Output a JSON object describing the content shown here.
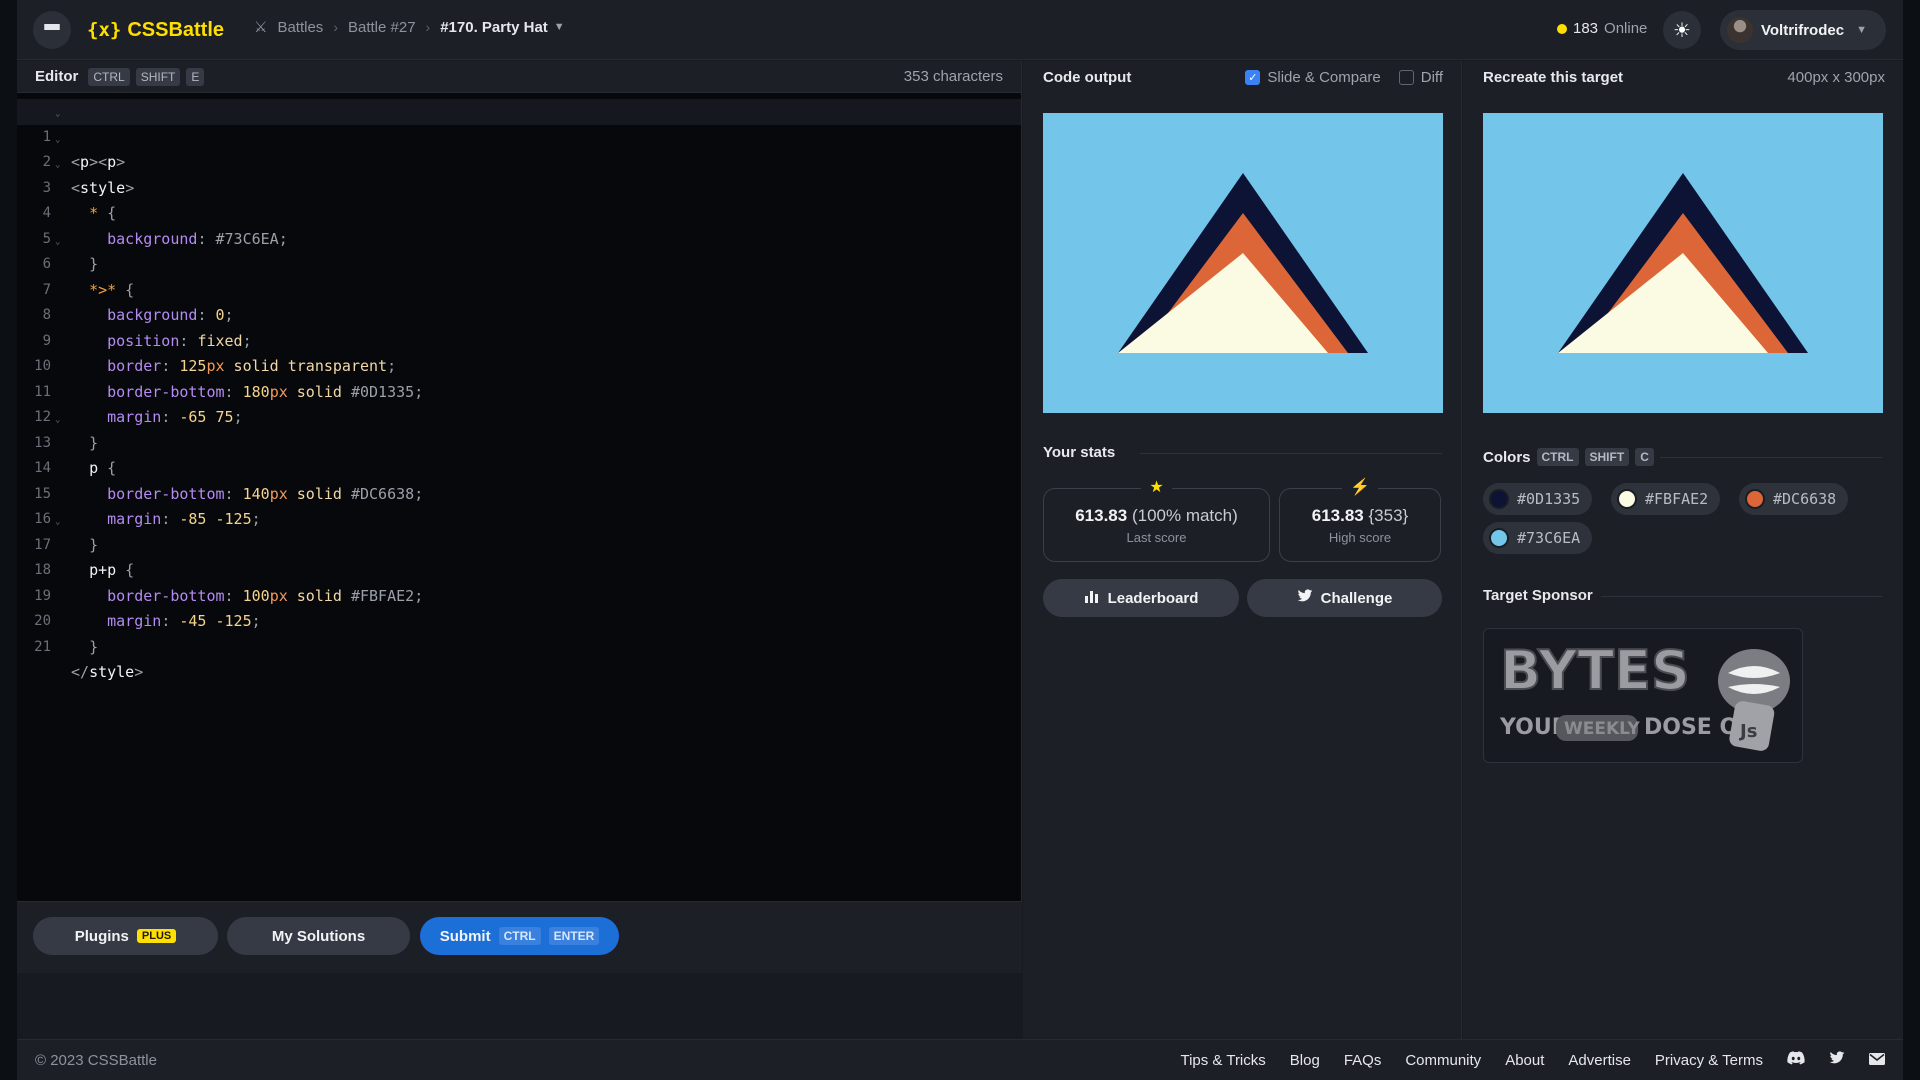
{
  "header": {
    "logo": "CSSBattle",
    "logo_mark": "{x}",
    "breadcrumbs": [
      "Battles",
      "Battle #27",
      "#170. Party Hat"
    ],
    "online_count": "183",
    "online_label": "Online",
    "username": "Voltrifrodec"
  },
  "editor": {
    "title": "Editor",
    "shortcut": [
      "CTRL",
      "SHIFT",
      "E"
    ],
    "char_count": "353 characters",
    "line_numbers": [
      "1",
      "2",
      "3",
      "4",
      "5",
      "6",
      "7",
      "8",
      "9",
      "10",
      "11",
      "12",
      "13",
      "14",
      "15",
      "16",
      "17",
      "18",
      "19",
      "20",
      "21"
    ],
    "code": {
      "l1a": "<",
      "l1b": "p",
      "l1c": "><",
      "l1d": "p",
      "l1e": ">",
      "l2a": "<",
      "l2b": "style",
      "l2c": ">",
      "l3a": "*",
      "l3b": " {",
      "l4a": "background",
      "l4b": ": ",
      "l4c": "#73C6EA",
      "l4d": ";",
      "l5": "}",
      "l6a": "*>*",
      "l6b": " {",
      "l7a": "background",
      "l7b": ": ",
      "l7c": "0",
      "l7d": ";",
      "l8a": "position",
      "l8b": ": ",
      "l8c": "fixed",
      "l8d": ";",
      "l9a": "border",
      "l9b": ": ",
      "l9c": "125",
      "l9u": "px",
      "l9e": " solid transparent",
      "l9d": ";",
      "l10a": "border-bottom",
      "l10b": ": ",
      "l10c": "180",
      "l10u": "px",
      "l10e": " solid ",
      "l10f": "#0D1335",
      "l10d": ";",
      "l11a": "margin",
      "l11b": ": ",
      "l11c": "-65 75",
      "l11d": ";",
      "l12": "}",
      "l13a": "p",
      "l13b": " {",
      "l14a": "border-bottom",
      "l14b": ": ",
      "l14c": "140",
      "l14u": "px",
      "l14e": " solid ",
      "l14f": "#DC6638",
      "l14d": ";",
      "l15a": "margin",
      "l15b": ": ",
      "l15c": "-85 -125",
      "l15d": ";",
      "l16": "}",
      "l17a": "p+p",
      "l17b": " {",
      "l18a": "border-bottom",
      "l18b": ": ",
      "l18c": "100",
      "l18u": "px",
      "l18e": " solid ",
      "l18f": "#FBFAE2",
      "l18d": ";",
      "l19a": "margin",
      "l19b": ": ",
      "l19c": "-45 -125",
      "l19d": ";",
      "l20": "}",
      "l21a": "</",
      "l21b": "style",
      "l21c": ">"
    }
  },
  "editor_footer": {
    "plugins_label": "Plugins",
    "plugins_badge": "PLUS",
    "solutions_label": "My Solutions",
    "submit_label": "Submit",
    "submit_keys": [
      "CTRL",
      "ENTER"
    ]
  },
  "output": {
    "title": "Code output",
    "slide_compare_label": "Slide & Compare",
    "slide_compare_checked": true,
    "diff_label": "Diff",
    "diff_checked": false,
    "stats_title": "Your stats",
    "last_score": "613.83",
    "last_score_detail": "(100% match)",
    "last_score_label": "Last score",
    "high_score": "613.83",
    "high_score_detail": "{353}",
    "high_score_label": "High score",
    "leaderboard_label": "Leaderboard",
    "challenge_label": "Challenge"
  },
  "target": {
    "title": "Recreate this target",
    "size": "400px x 300px",
    "colors_title": "Colors",
    "colors_keys": [
      "CTRL",
      "SHIFT",
      "C"
    ],
    "colors": [
      "#0D1335",
      "#FBFAE2",
      "#DC6638",
      "#73C6EA"
    ],
    "sponsor_title": "Target Sponsor",
    "sponsor_brand": "BYTES",
    "sponsor_tagline_1": "YOUR",
    "sponsor_tagline_2": "WEEKLY",
    "sponsor_tagline_3": "DOSE OF",
    "sponsor_js": "Js"
  },
  "footer": {
    "copyright": "© 2023 CSSBattle",
    "links": [
      "Tips & Tricks",
      "Blog",
      "FAQs",
      "Community",
      "About",
      "Advertise",
      "Privacy & Terms"
    ]
  },
  "palette": {
    "accent": "#ffdf00",
    "submit": "#1d6fd8",
    "target_bg": "#73C6EA",
    "hat_dark": "#0D1335",
    "hat_orange": "#DC6638",
    "hat_cream": "#FBFAE2"
  }
}
